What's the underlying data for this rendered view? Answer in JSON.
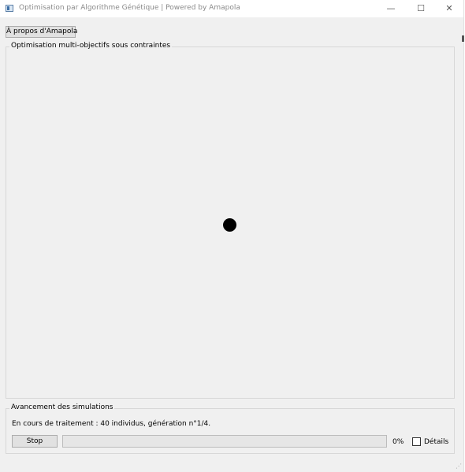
{
  "window": {
    "title": "Optimisation par Algorithme Génétique | Powered by Amapola",
    "controls": {
      "minimize": "—",
      "maximize": "☐",
      "close": "✕"
    }
  },
  "toolbar": {
    "about_label": "À propos d'Amapola"
  },
  "main_group": {
    "label": "Optimisation multi-objectifs sous contraintes"
  },
  "simulation": {
    "group_label": "Avancement des simulations",
    "status": "En cours de traitement : 40 individus, génération n°1/4.",
    "stop_label": "Stop",
    "progress_percent": 0,
    "progress_text": "0%",
    "details_label": "Détails",
    "details_checked": false
  },
  "icons": {
    "resize_grip": "resize-grip-icon",
    "busy": "busy-indicator-icon"
  }
}
